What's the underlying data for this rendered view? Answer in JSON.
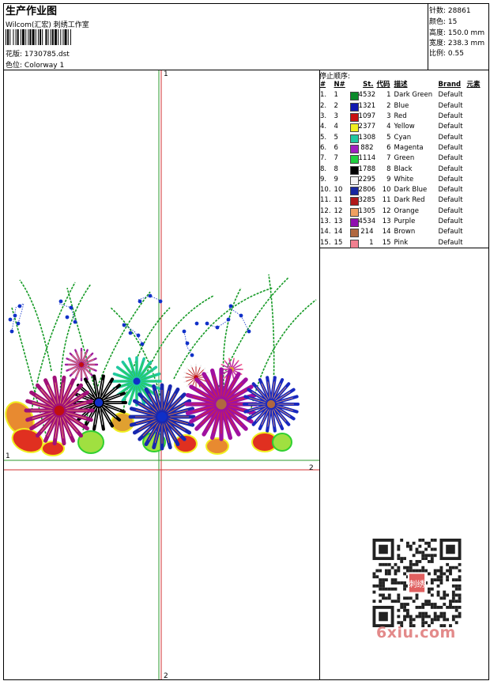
{
  "header": {
    "title": "生产作业图",
    "subtitle": "Wilcom(汇宏) 刺绣工作室",
    "design_label": "花版:",
    "design_file": "1730785.dst",
    "colorway_label": "色位:",
    "colorway": "Colorway 1"
  },
  "stats": [
    {
      "label": "针数:",
      "value": "28861"
    },
    {
      "label": "颜色:",
      "value": "15"
    },
    {
      "label": "高度:",
      "value": "150.0 mm"
    },
    {
      "label": "宽度:",
      "value": "238.3 mm"
    },
    {
      "label": "比例:",
      "value": "0.55"
    }
  ],
  "stop_sequence": {
    "title": "停止顺序:",
    "columns": [
      "#",
      "N#",
      "St.",
      "代码",
      "描述",
      "Brand",
      "元素"
    ],
    "rows": [
      {
        "idx": "1.",
        "n": "1",
        "color": "#0a8a2a",
        "st": "4532",
        "code": "1",
        "desc": "Dark Green",
        "brand": "Default"
      },
      {
        "idx": "2.",
        "n": "2",
        "color": "#1018b0",
        "st": "1321",
        "code": "2",
        "desc": "Blue",
        "brand": "Default"
      },
      {
        "idx": "3.",
        "n": "3",
        "color": "#c81010",
        "st": "1097",
        "code": "3",
        "desc": "Red",
        "brand": "Default"
      },
      {
        "idx": "4.",
        "n": "4",
        "color": "#f0f020",
        "st": "2377",
        "code": "4",
        "desc": "Yellow",
        "brand": "Default"
      },
      {
        "idx": "5.",
        "n": "5",
        "color": "#20c8a0",
        "st": "1308",
        "code": "5",
        "desc": "Cyan",
        "brand": "Default"
      },
      {
        "idx": "6.",
        "n": "6",
        "color": "#a020c0",
        "st": "882",
        "code": "6",
        "desc": "Magenta",
        "brand": "Default"
      },
      {
        "idx": "7.",
        "n": "7",
        "color": "#20d040",
        "st": "1114",
        "code": "7",
        "desc": "Green",
        "brand": "Default"
      },
      {
        "idx": "8.",
        "n": "8",
        "color": "#000000",
        "st": "1788",
        "code": "8",
        "desc": "Black",
        "brand": "Default"
      },
      {
        "idx": "9.",
        "n": "9",
        "color": "#f4f4f4",
        "st": "2295",
        "code": "9",
        "desc": "White",
        "brand": "Default"
      },
      {
        "idx": "10.",
        "n": "10",
        "color": "#1828a0",
        "st": "2806",
        "code": "10",
        "desc": "Dark Blue",
        "brand": "Default"
      },
      {
        "idx": "11.",
        "n": "11",
        "color": "#b01818",
        "st": "3285",
        "code": "11",
        "desc": "Dark Red",
        "brand": "Default"
      },
      {
        "idx": "12.",
        "n": "12",
        "color": "#f0a060",
        "st": "1305",
        "code": "12",
        "desc": "Orange",
        "brand": "Default"
      },
      {
        "idx": "13.",
        "n": "13",
        "color": "#9010b0",
        "st": "4534",
        "code": "13",
        "desc": "Purple",
        "brand": "Default"
      },
      {
        "idx": "14.",
        "n": "14",
        "color": "#b06840",
        "st": "214",
        "code": "14",
        "desc": "Brown",
        "brand": "Default"
      },
      {
        "idx": "15.",
        "n": "15",
        "color": "#f08090",
        "st": "1",
        "code": "15",
        "desc": "Pink",
        "brand": "Default"
      }
    ]
  },
  "axes": {
    "v_top": "1",
    "v_bottom": "2",
    "h_left": "1",
    "h_right": "2"
  },
  "watermark": {
    "site": "6xiu.com",
    "qr_text": "刺绣"
  }
}
